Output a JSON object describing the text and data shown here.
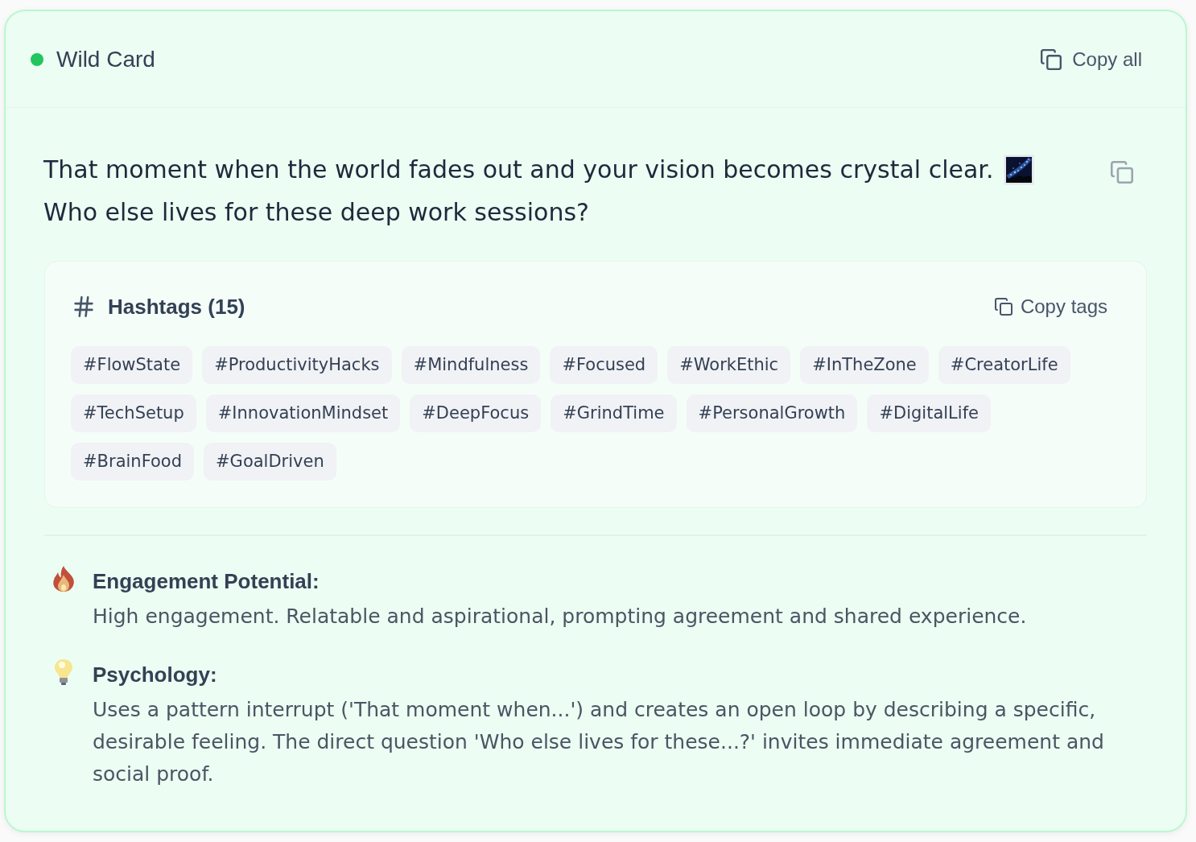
{
  "card": {
    "title": "Wild Card",
    "copy_all_label": "Copy all"
  },
  "post": {
    "sentences": [
      "That moment when the world fades out and your vision becomes crystal clear.",
      "Who else lives for these deep work sessions?"
    ]
  },
  "hashtags": {
    "title": "Hashtags (15)",
    "copy_label": "Copy tags",
    "tags": [
      "#FlowState",
      "#ProductivityHacks",
      "#Mindfulness",
      "#Focused",
      "#WorkEthic",
      "#InTheZone",
      "#CreatorLife",
      "#TechSetup",
      "#InnovationMindset",
      "#DeepFocus",
      "#GrindTime",
      "#PersonalGrowth",
      "#DigitalLife",
      "#BrainFood",
      "#GoalDriven"
    ]
  },
  "insights": [
    {
      "kind": "engagement",
      "heading": "Engagement Potential:",
      "text": "High engagement. Relatable and aspirational, prompting agreement and shared experience."
    },
    {
      "kind": "psychology",
      "heading": "Psychology:",
      "text": "Uses a pattern interrupt ('That moment when...') and creates an open loop by describing a specific, desirable feeling. The direct question 'Who else lives for these...?' invites immediate agreement and social proof."
    }
  ]
}
